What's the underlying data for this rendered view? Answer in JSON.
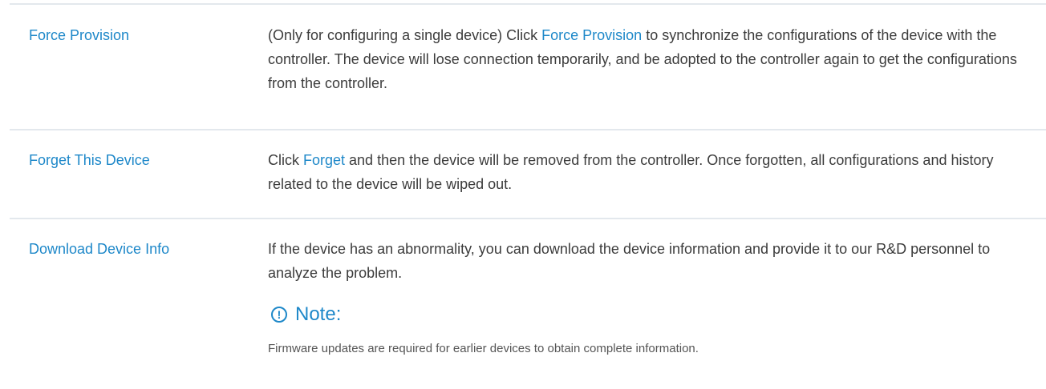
{
  "rows": [
    {
      "name": "Force Provision",
      "desc_before": "(Only for configuring a single device) Click ",
      "desc_link": "Force Provision",
      "desc_after": " to synchronize the configurations of the device with the controller. The device will lose connection temporarily, and be adopted to the controller again to get the configurations from the controller."
    },
    {
      "name": "Forget This Device",
      "desc_before": "Click ",
      "desc_link": "Forget",
      "desc_after": " and then the device will be removed from the controller. Once forgotten, all configurations and history related to the device will be wiped out."
    },
    {
      "name": "Download Device Info",
      "desc": "If the device has an abnormality, you can download the device information and provide it to our R&D personnel to analyze the problem.",
      "note_icon": "!",
      "note_title": "Note:",
      "note_text": "Firmware updates are required for earlier devices to obtain complete information."
    }
  ],
  "colors": {
    "link": "#1e88c9",
    "text": "#3c3c3c",
    "divider": "#e3e8ed"
  }
}
